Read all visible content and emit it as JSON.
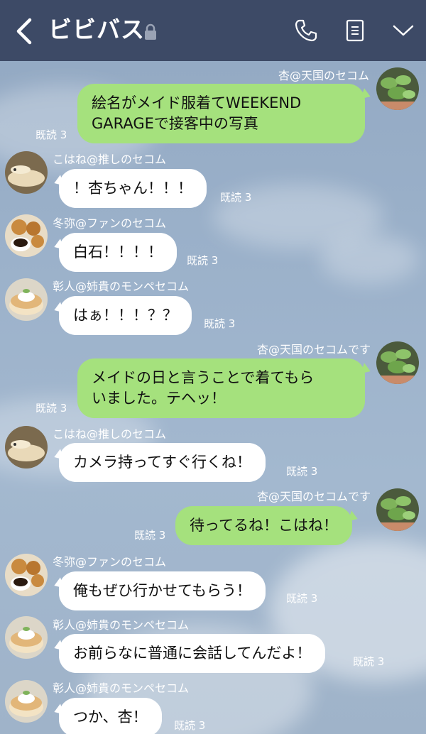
{
  "header": {
    "title": "ビビバス",
    "back_icon": "chevron-left-icon",
    "lock_icon": "lock-icon",
    "call_icon": "phone-icon",
    "notes_icon": "memo-icon",
    "menu_icon": "chevron-down-icon",
    "background_color": "#3d4a66"
  },
  "colors": {
    "outgoing_bubble": "#a5e17d",
    "incoming_bubble": "#ffffff"
  },
  "messages": [
    {
      "sender": "杏@天国のセコム",
      "direction": "out",
      "text_lines": [
        "絵名がメイド服着てWEEKEND",
        "GARAGEで接客中の写真"
      ],
      "read": "既読 3",
      "avatar": "plant"
    },
    {
      "sender": "こはね@推しのセコム",
      "direction": "in",
      "text_lines": [
        "！杏ちゃん！！！"
      ],
      "read": "既読 3",
      "avatar": "snake"
    },
    {
      "sender": "冬弥@ファンのセコム",
      "direction": "in",
      "text_lines": [
        "白石！！！！"
      ],
      "read": "既読 3",
      "avatar": "cookies"
    },
    {
      "sender": "彰人@姉貴のモンペセコム",
      "direction": "in",
      "text_lines": [
        "はぁ！！！？？"
      ],
      "read": "既読 3",
      "avatar": "pancake"
    },
    {
      "sender": "杏@天国のセコムです",
      "direction": "out",
      "text_lines": [
        "メイドの日と言うことで着てもら",
        "いました。テヘッ！"
      ],
      "read": "既読 3",
      "avatar": "plant"
    },
    {
      "sender": "こはね@推しのセコム",
      "direction": "in",
      "text_lines": [
        "カメラ持ってすぐ行くね！"
      ],
      "read": "既読 3",
      "avatar": "snake"
    },
    {
      "sender": "杏@天国のセコムです",
      "direction": "out",
      "text_lines": [
        "待ってるね！こはね！"
      ],
      "read": "既読 3",
      "avatar": "plant"
    },
    {
      "sender": "冬弥@ファンのセコム",
      "direction": "in",
      "text_lines": [
        "俺もぜひ行かせてもらう！"
      ],
      "read": "既読 3",
      "avatar": "cookies"
    },
    {
      "sender": "彰人@姉貴のモンペセコム",
      "direction": "in",
      "text_lines": [
        "お前らなに普通に会話してんだよ！"
      ],
      "read": "既読 3",
      "avatar": "pancake"
    },
    {
      "sender": "彰人@姉貴のモンペセコム",
      "direction": "in",
      "text_lines": [
        "つか、杏！"
      ],
      "read": "既読 3",
      "avatar": "pancake"
    }
  ]
}
